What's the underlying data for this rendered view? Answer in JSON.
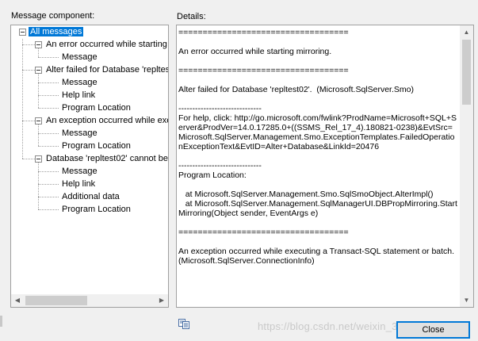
{
  "left_label": "Message component:",
  "right_label": "Details:",
  "tree": [
    {
      "text": "All messages",
      "level": 0,
      "toggle": true,
      "selected": true
    },
    {
      "text": "An error occurred while starting m",
      "level": 1,
      "toggle": true
    },
    {
      "text": "Message",
      "level": 2,
      "toggle": false
    },
    {
      "text": "Alter failed for Database 'repltest",
      "level": 1,
      "toggle": true
    },
    {
      "text": "Message",
      "level": 2,
      "toggle": false
    },
    {
      "text": "Help link",
      "level": 2,
      "toggle": false
    },
    {
      "text": "Program Location",
      "level": 2,
      "toggle": false
    },
    {
      "text": "An exception occurred while exe",
      "level": 1,
      "toggle": true
    },
    {
      "text": "Message",
      "level": 2,
      "toggle": false
    },
    {
      "text": "Program Location",
      "level": 2,
      "toggle": false
    },
    {
      "text": "Database 'repltest02' cannot be",
      "level": 1,
      "toggle": true
    },
    {
      "text": "Message",
      "level": 2,
      "toggle": false
    },
    {
      "text": "Help link",
      "level": 2,
      "toggle": false
    },
    {
      "text": "Additional data",
      "level": 2,
      "toggle": false
    },
    {
      "text": "Program Location",
      "level": 2,
      "toggle": false
    }
  ],
  "details_text": "===================================\n\nAn error occurred while starting mirroring.\n\n===================================\n\nAlter failed for Database 'repltest02'.  (Microsoft.SqlServer.Smo)\n\n------------------------------\nFor help, click: http://go.microsoft.com/fwlink?ProdName=Microsoft+SQL+Server&ProdVer=14.0.17285.0+((SSMS_Rel_17_4).180821-0238)&EvtSrc=Microsoft.SqlServer.Management.Smo.ExceptionTemplates.FailedOperationExceptionText&EvtID=Alter+Database&LinkId=20476\n\n------------------------------\nProgram Location:\n\n   at Microsoft.SqlServer.Management.Smo.SqlSmoObject.AlterImpl()\n   at Microsoft.SqlServer.Management.SqlManagerUI.DBPropMirroring.StartMirroring(Object sender, EventArgs e)\n\n===================================\n\nAn exception occurred while executing a Transact-SQL statement or batch. (Microsoft.SqlServer.ConnectionInfo)",
  "close_label": "Close",
  "watermark": "https://blog.csdn.net/weixin_38993527",
  "icons": {
    "copy": "copy-icon"
  },
  "colors": {
    "selection": "#0078d7",
    "button_border": "#0078d7"
  }
}
